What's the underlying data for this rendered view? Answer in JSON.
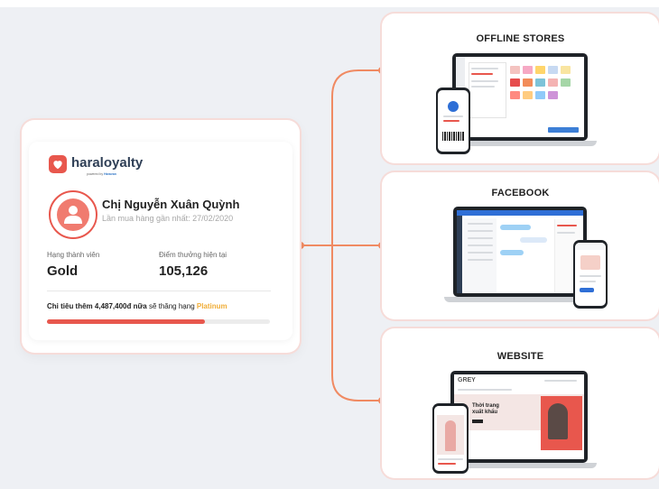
{
  "loyalty_card": {
    "logo_text": "haraloyalty",
    "logo_powered_by": "powered by",
    "logo_powered_brand": "Haravan",
    "customer_name": "Chị Nguyễn Xuân Quỳnh",
    "last_purchase": "Lần mua hàng gần nhất: 27/02/2020",
    "member_tier_label": "Hạng thành viên",
    "member_tier_value": "Gold",
    "points_label": "Điểm thưởng hiện tại",
    "points_value": "105,126",
    "upgrade_prefix": "Chi tiêu thêm 4,487,400đ nữa",
    "upgrade_middle": " sẽ thăng hạng ",
    "upgrade_tier": "Platinum",
    "progress_fraction": 0.71
  },
  "channels": [
    {
      "title": "OFFLINE STORES"
    },
    {
      "title": "FACEBOOK"
    },
    {
      "title": "WEBSITE"
    }
  ],
  "website_preview": {
    "brand": "GREY",
    "hero_text_line1": "Thời trang",
    "hero_text_line2": "xuất khẩu"
  },
  "colors": {
    "accent": "#e8574d",
    "connector": "#f08a62",
    "gold_text": "#f0ad37",
    "background": "#eef0f4"
  },
  "icons": {
    "logo": "heart-icon",
    "avatar": "user-icon"
  }
}
